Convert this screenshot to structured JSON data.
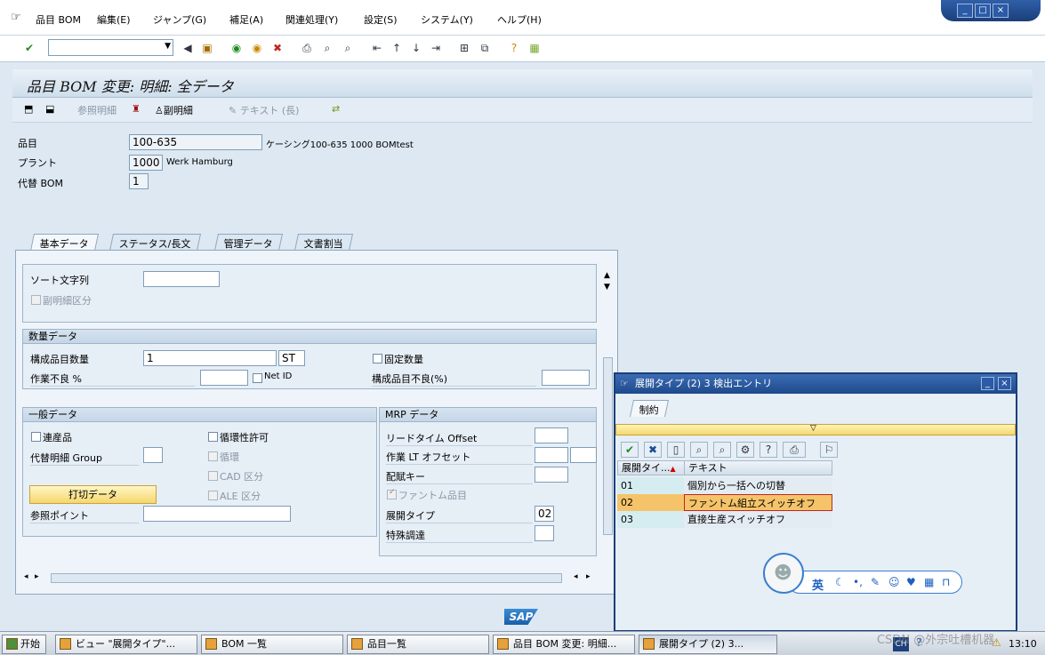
{
  "menu": [
    "品目 BOM",
    "編集(E)",
    "ジャンプ(G)",
    "補足(A)",
    "関連処理(Y)",
    "設定(S)",
    "システム(Y)",
    "ヘルプ(H)"
  ],
  "window_controls": [
    "_",
    "□",
    "×"
  ],
  "title": "品目 BOM 変更: 明細: 全データ",
  "toolbar2": {
    "ref_item": "参照明細",
    "sub_item": "副明細",
    "text": "テキスト (長)"
  },
  "header": {
    "material_label": "品目",
    "material_value": "100-635",
    "material_desc": "ケーシング100-635 1000 BOMtest",
    "plant_label": "プラント",
    "plant_value": "1000",
    "plant_desc": "Werk Hamburg",
    "alt_bom_label": "代替 BOM",
    "alt_bom_value": "1"
  },
  "tabs": [
    "基本データ",
    "ステータス/長文",
    "管理データ",
    "文書割当"
  ],
  "basic": {
    "sort_label": "ソート文字列",
    "sub_item_label": "副明細区分",
    "qty_group": "数量データ",
    "comp_qty_label": "構成品目数量",
    "comp_qty_value": "1",
    "unit_value": "ST",
    "fixed_qty_label": "固定数量",
    "op_scrap_label": "作業不良 %",
    "net_id_label": "Net ID",
    "comp_scrap_label": "構成品目不良(%)",
    "general_group": "一般データ",
    "coproduct_label": "連産品",
    "recursive_allowed_label": "循環性許可",
    "alt_group_label": "代替明細 Group",
    "recursive_label": "循環",
    "cad_label": "CAD 区分",
    "discontinue_button": "打切データ",
    "ale_label": "ALE 区分",
    "ref_point_label": "参照ポイント",
    "mrp_group": "MRP データ",
    "lead_time_label": "リードタイム Offset",
    "op_lt_label": "作業 LT オフセット",
    "dist_key_label": "配賦キー",
    "phantom_label": "ファントム品目",
    "explosion_type_label": "展開タイプ",
    "explosion_type_value": "02",
    "special_proc_label": "特殊調達"
  },
  "popup": {
    "title": "展開タイプ (2)    3 検出エントリ",
    "tab": "制約",
    "col1": "展開タイ...",
    "col2": "テキスト",
    "rows": [
      {
        "code": "01",
        "text": "個別から一括への切替"
      },
      {
        "code": "02",
        "text": "ファントム組立スイッチオフ"
      },
      {
        "code": "03",
        "text": "直接生産スイッチオフ"
      }
    ]
  },
  "sap_logo": "SAP",
  "ime": {
    "lang": "英"
  },
  "taskbar": {
    "start": "开始",
    "tasks": [
      "ビュー \"展開タイプ\"...",
      "BOM 一覧",
      "品目一覧",
      "品目 BOM 変更: 明細...",
      "展開タイプ (2)    3..."
    ],
    "tray_lang": "CH",
    "time": "13:10",
    "watermark": "CSDN @外宗吐槽机器"
  }
}
